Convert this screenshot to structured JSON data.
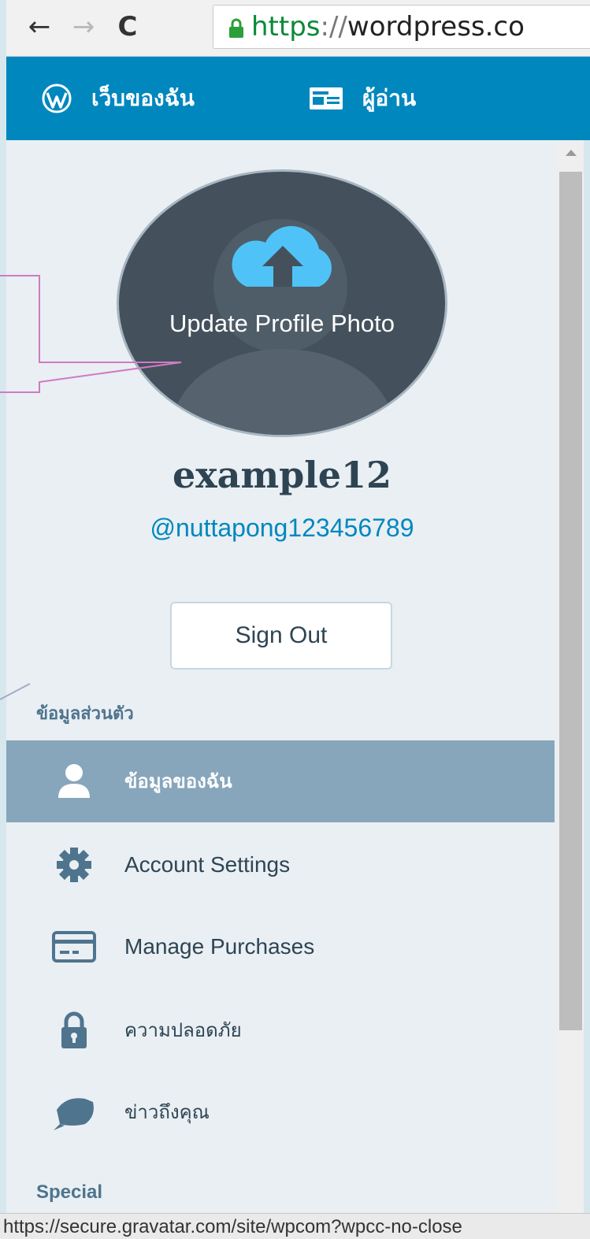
{
  "browser": {
    "back_glyph": "←",
    "forward_glyph": "→",
    "reload_glyph": "C",
    "url": {
      "scheme": "https",
      "separator": "://",
      "host": "wordpress.co"
    }
  },
  "masterbar": {
    "my_sites_label": "เว็บของฉัน",
    "reader_label": "ผู้อ่าน",
    "icons": [
      "wordpress-logo-icon",
      "reader-icon"
    ]
  },
  "profile": {
    "update_photo_label": "Update Profile Photo",
    "display_name": "example12",
    "username": "@nuttapong123456789",
    "sign_out_label": "Sign Out"
  },
  "sidebar": {
    "section_title": "ข้อมูลส่วนตัว",
    "items": [
      {
        "label": "ข้อมูลของฉัน",
        "icon": "user-icon",
        "active": true
      },
      {
        "label": "Account Settings",
        "icon": "gear-icon",
        "active": false
      },
      {
        "label": "Manage Purchases",
        "icon": "credit-card-icon",
        "active": false
      },
      {
        "label": "ความปลอดภัย",
        "icon": "lock-icon",
        "active": false
      },
      {
        "label": "ข่าวถึงคุณ",
        "icon": "notifications-icon",
        "active": false
      }
    ],
    "special_title": "Special"
  },
  "statusbar": {
    "text": "https://secure.gravatar.com/site/wpcom?wpcc-no-close"
  },
  "colors": {
    "masterbar": "#0087be",
    "sidebar_bg": "#e9eff3",
    "active_item": "#87a6bc",
    "link": "#0087be",
    "text": "#2e4453",
    "callout_stroke": "#d17ac2"
  }
}
